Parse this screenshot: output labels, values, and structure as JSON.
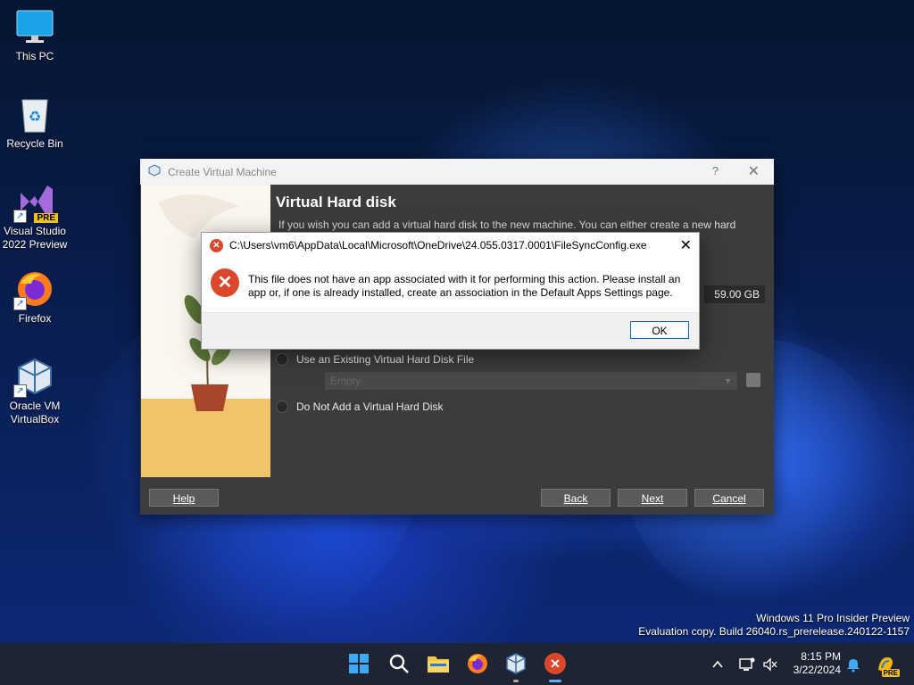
{
  "desktop": {
    "icons": [
      {
        "label": "This PC",
        "icon": "monitor-icon"
      },
      {
        "label": "Recycle Bin",
        "icon": "recycle-bin-icon"
      },
      {
        "label": "Visual Studio\n2022 Preview",
        "icon": "visual-studio-icon",
        "badge": "PRE"
      },
      {
        "label": "Firefox",
        "icon": "firefox-icon"
      },
      {
        "label": "Oracle VM\nVirtualBox",
        "icon": "virtualbox-icon"
      }
    ]
  },
  "wizard": {
    "title": "Create Virtual Machine",
    "help_glyph": "?",
    "close_glyph": "✕",
    "heading": "Virtual Hard disk",
    "intro": "If you wish you can add a virtual hard disk to the new machine. You can either create a new hard",
    "disk_size": "59.00 GB",
    "option_existing": "Use an Existing Virtual Hard Disk File",
    "existing_combo": "Empty",
    "option_none": "Do Not Add a Virtual Hard Disk",
    "buttons": {
      "help": "Help",
      "back": "Back",
      "next": "Next",
      "cancel": "Cancel"
    }
  },
  "error_dialog": {
    "title": "C:\\Users\\vm6\\AppData\\Local\\Microsoft\\OneDrive\\24.055.0317.0001\\FileSyncConfig.exe",
    "message_line1": "This file does not have an app associated with it for performing this action. Please install an",
    "message_line2": "app or, if one is already installed, create an association in the Default Apps Settings page.",
    "ok_label": "OK",
    "close_glyph": "✕"
  },
  "watermark": {
    "line1": "Windows 11 Pro Insider Preview",
    "line2": "Evaluation copy. Build 26040.rs_prerelease.240122-1157"
  },
  "taskbar": {
    "apps": [
      "start-icon",
      "search-icon",
      "file-explorer-icon",
      "firefox-icon",
      "virtualbox-icon",
      "error-app-icon"
    ],
    "tray_chevron": "^",
    "time": "8:15 PM",
    "date": "3/22/2024",
    "copilot_badge": "PRE"
  },
  "colors": {
    "error_red": "#d9482b",
    "accent_blue": "#0067c0",
    "taskbar_bg": "#1e2433"
  }
}
